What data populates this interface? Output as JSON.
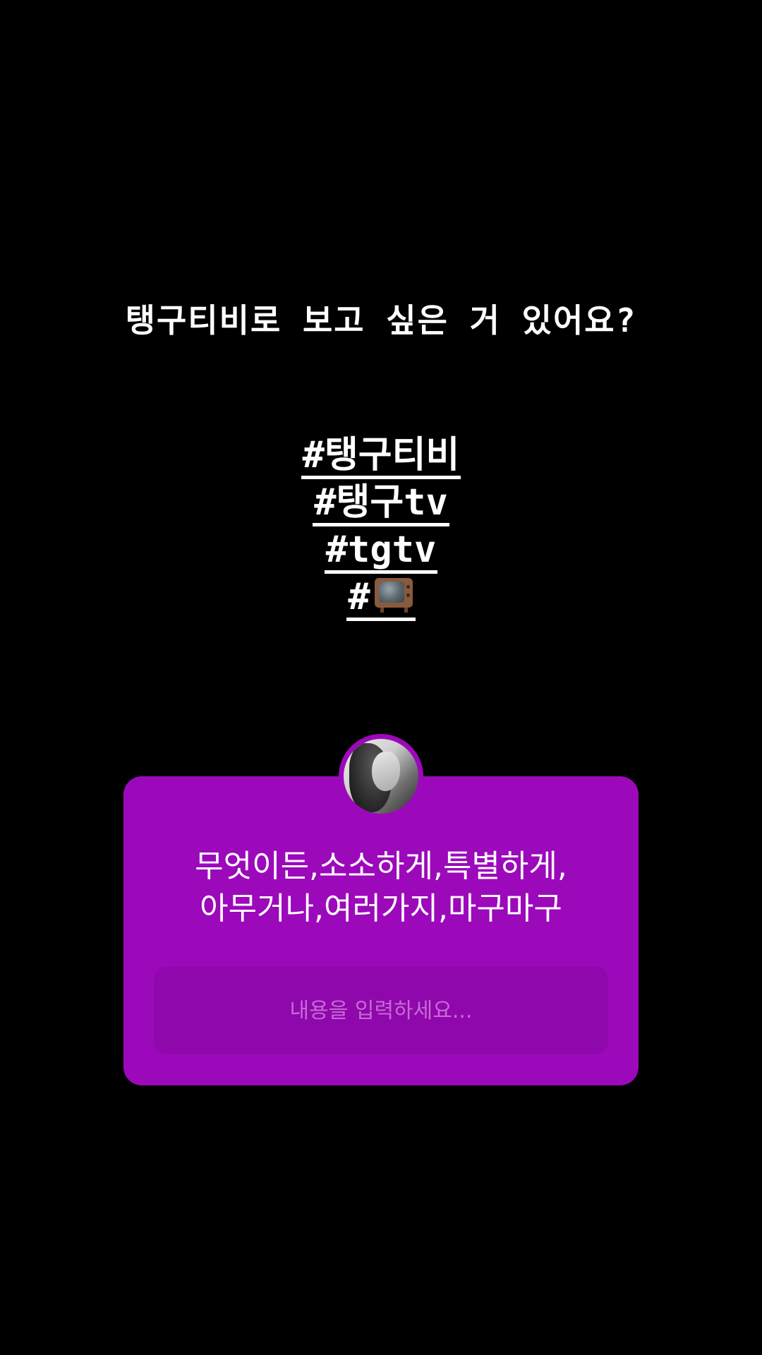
{
  "story": {
    "caption": "탱구티비로 보고 싶은 거 있어요?",
    "hashtags": [
      {
        "text": "#탱구티비"
      },
      {
        "text": "#탱구tv"
      },
      {
        "text": "#tgtv"
      },
      {
        "text": "#",
        "icon": "television-emoji"
      }
    ]
  },
  "question_sticker": {
    "avatar_icon": "profile-avatar",
    "question_line1": "무엇이든,소소하게,특별하게,",
    "question_line2": "아무거나,여러가지,마구마구",
    "input_placeholder": "내용을 입력하세요...",
    "input_value": "",
    "background_color": "#9c09bb",
    "input_color": "#8f08ab"
  }
}
